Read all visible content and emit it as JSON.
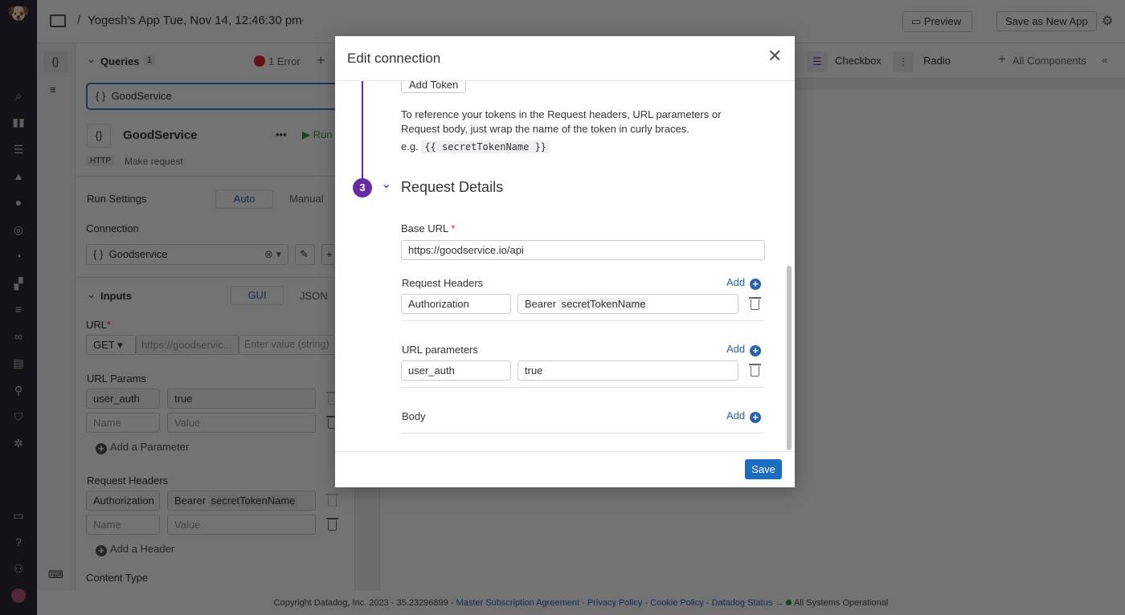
{
  "header": {
    "app_title": "Yogesh's App Tue, Nov 14, 12:46:30 pm",
    "preview": "Preview",
    "save_as_new": "Save as New App"
  },
  "components": {
    "checkbox": "Checkbox",
    "radio": "Radio",
    "all": "All Components"
  },
  "queries": {
    "title": "Queries",
    "count": "1",
    "errors": "1 Error",
    "item": "GoodService"
  },
  "query": {
    "name": "GoodService",
    "type": "HTTP",
    "action": "Make request",
    "run": "Run",
    "run_settings": "Run Settings",
    "auto": "Auto",
    "manual": "Manual",
    "connection_label": "Connection",
    "connection_value": "Goodservice"
  },
  "inputs": {
    "title": "Inputs",
    "gui": "GUI",
    "json": "JSON",
    "url_label": "URL",
    "method": "GET",
    "url_placeholder": "https://goodservic...",
    "value_placeholder": "Enter value (string)",
    "url_params_label": "URL Params",
    "param_name": "user_auth",
    "param_value": "true",
    "name_placeholder": "Name",
    "val_placeholder": "Value",
    "add_param": "Add a Parameter",
    "headers_label": "Request Headers",
    "header_name": "Authorization",
    "header_prefix": "Bearer",
    "header_token": "secretTokenName",
    "add_header": "Add a Header",
    "content_type": "Content Type"
  },
  "footer": {
    "copyright": "Copyright Datadog, Inc. 2023 - 35.23296899 -",
    "msa": "Master Subscription Agreement",
    "privacy": "Privacy Policy",
    "cookie": "Cookie Policy",
    "status": "Datadog Status →",
    "operational": "All Systems Operational",
    "sep": "-"
  },
  "modal": {
    "title": "Edit connection",
    "add_token": "Add Token",
    "token_help": "To reference your tokens in the Request headers, URL parameters or Request body, just wrap the name of the token in curly braces.",
    "eg": "e.g.",
    "eg_code": "{{ secretTokenName }}",
    "step": "3",
    "section": "Request Details",
    "base_url_label": "Base URL",
    "required": "*",
    "base_url": "https://goodservice.io/api",
    "req_headers": "Request Headers",
    "add": "Add",
    "header_name": "Authorization",
    "header_prefix": "Bearer",
    "header_token": "secretTokenName",
    "url_params": "URL parameters",
    "param_name": "user_auth",
    "param_value": "true",
    "body": "Body",
    "save": "Save"
  },
  "colors": {
    "accent": "#632ca6",
    "link": "#2563b5",
    "save": "#1a6ec2",
    "error": "#e0262f"
  }
}
